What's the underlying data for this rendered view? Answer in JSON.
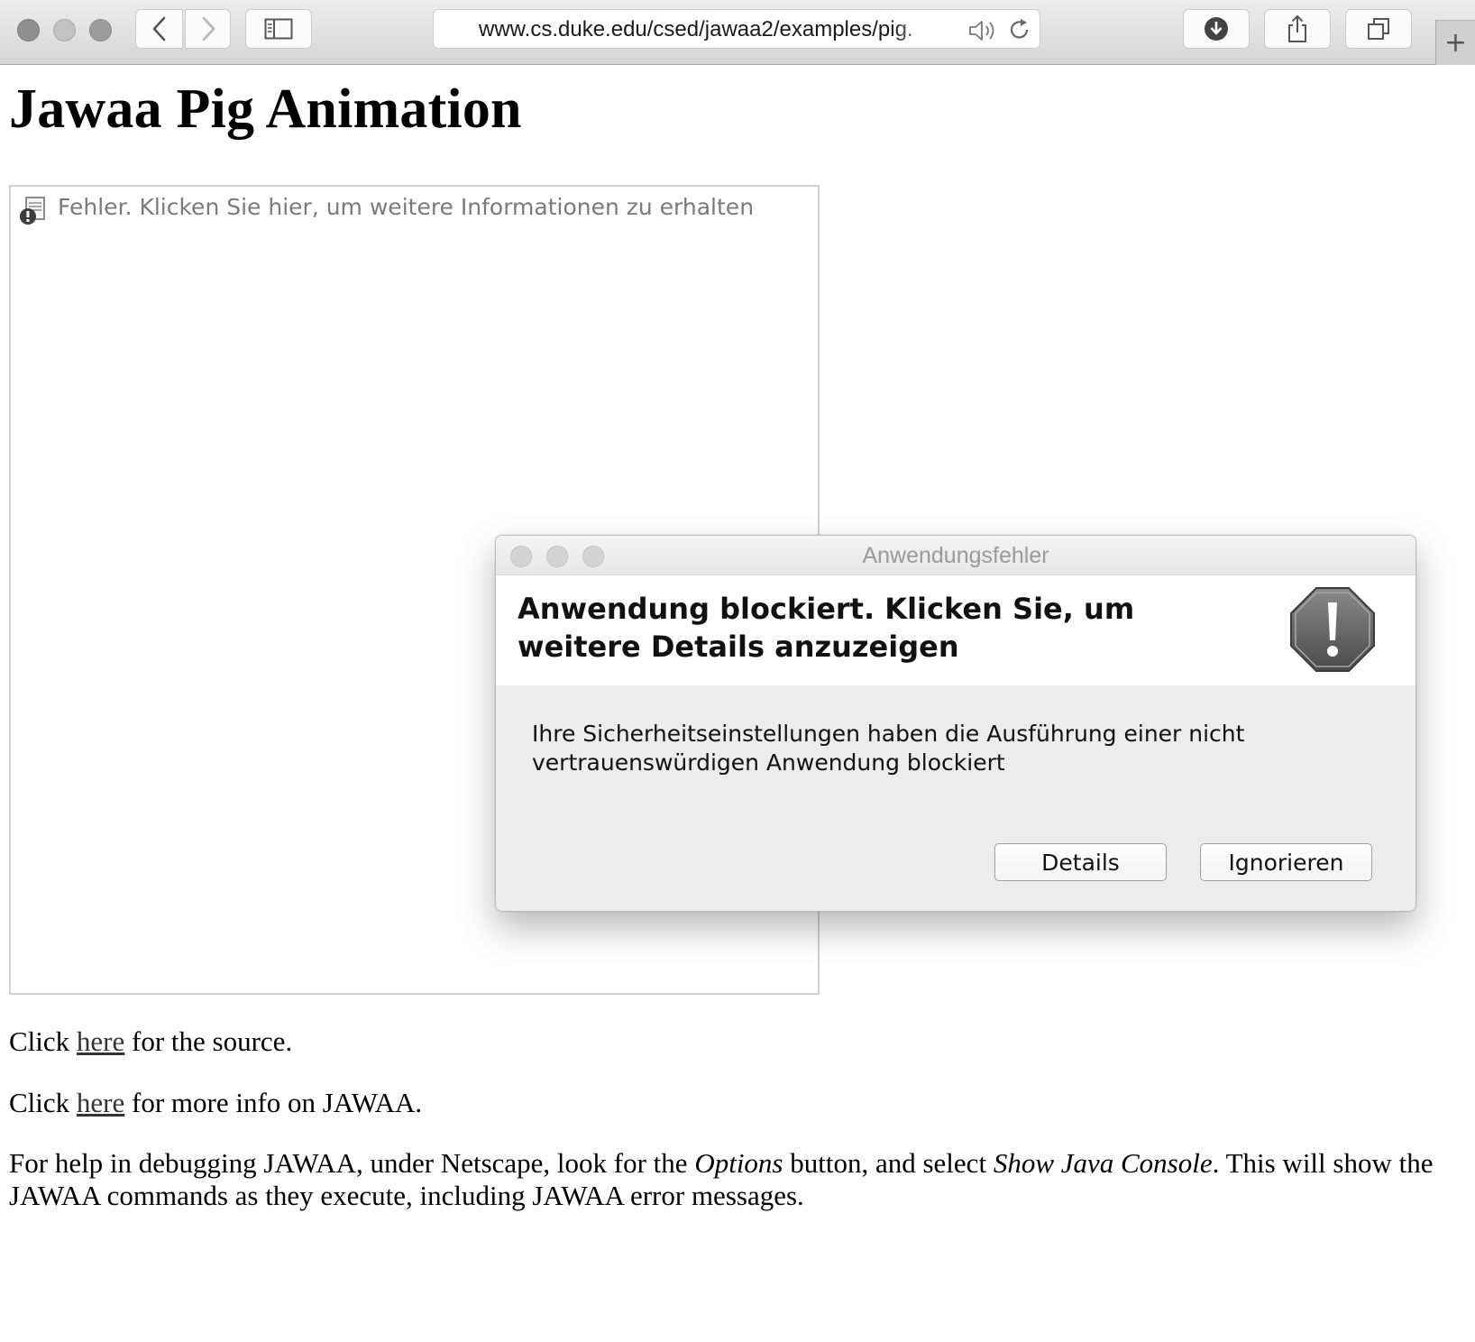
{
  "browser": {
    "url": "www.cs.duke.edu/csed/jawaa2/examples/pig.",
    "new_tab_label": "+"
  },
  "page": {
    "title": "Jawaa Pig Animation",
    "applet_error": "Fehler. Klicken Sie hier, um weitere Informationen zu erhalten",
    "para1": {
      "before": "Click ",
      "link": "here",
      "after": " for the source."
    },
    "para2": {
      "before": "Click ",
      "link": "here",
      "after": " for more info on JAWAA."
    },
    "para3": {
      "t1": "For help in debugging JAWAA, under Netscape, look for the ",
      "em1": "Options",
      "t2": " button, and select ",
      "em2": "Show Java Console",
      "t3": ". This will show the JAWAA commands as they execute, including JAWAA error messages."
    }
  },
  "dialog": {
    "title": "Anwendungsfehler",
    "heading": "Anwendung blockiert. Klicken Sie, um weitere Details anzuzeigen",
    "body": "Ihre Sicherheitseinstellungen haben die Ausführung einer nicht vertrauenswürdigen Anwendung blockiert",
    "details_label": "Details",
    "ignore_label": "Ignorieren"
  },
  "icons": [
    "back-icon",
    "forward-icon",
    "sidebar-icon",
    "speaker-icon",
    "reload-icon",
    "download-icon",
    "share-icon",
    "tabs-icon",
    "applet-error-icon",
    "warning-icon"
  ]
}
